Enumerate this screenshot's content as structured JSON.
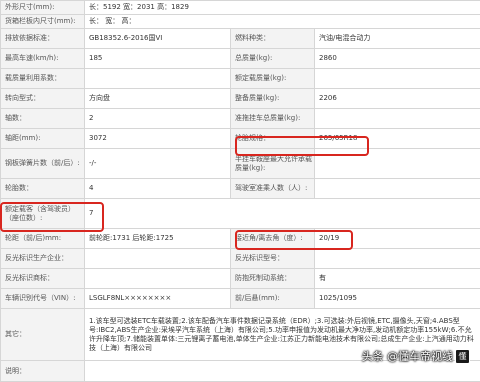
{
  "rows": [
    {
      "k1": "外形尺寸(mm):",
      "v1": "长：5192 宽：2031 高：1829",
      "k2": "",
      "v2": ""
    },
    {
      "k1": "货箱栏板内尺寸(mm):",
      "v1": "长：    宽：    高：",
      "k2": "",
      "v2": ""
    },
    {
      "k1": "排放依据标准：",
      "v1": "GB18352.6-2016国VI",
      "k2": "燃料种类：",
      "v2": "汽油/电混合动力"
    },
    {
      "k1": "最高车速(km/h):",
      "v1": "185",
      "k2": "总质量(kg):",
      "v2": "2860"
    },
    {
      "k1": "载质量利用系数：",
      "v1": "",
      "k2": "额定载质量(kg):",
      "v2": ""
    },
    {
      "k1": "转向型式：",
      "v1": "方向盘",
      "k2": "整备质量(kg):",
      "v2": "2206"
    },
    {
      "k1": "轴数：",
      "v1": "2",
      "k2": "准拖挂车总质量(kg):",
      "v2": ""
    },
    {
      "k1": "轴距(mm):",
      "v1": "3072",
      "k2": "轮胎规格：",
      "v2": "265/65R18"
    },
    {
      "k1": "钢板弹簧片数（前/后）:",
      "v1": "-/-",
      "k2": "半挂车鞍座最大允许承载质量(kg):",
      "v2": ""
    },
    {
      "k1": "轮胎数：",
      "v1": "4",
      "k2": "驾驶室准乘人数（人）:",
      "v2": ""
    },
    {
      "k1": "额定载客（含驾驶员）（座位数）:",
      "v1": "7",
      "k2": "",
      "v2": ""
    },
    {
      "k1": "轮距（前/后)mm:",
      "v1": "前轮距:1731 后轮距:1725",
      "k2": "接近角/离去角（度）:",
      "v2": "20/19"
    },
    {
      "k1": "反光标识生产企业：",
      "v1": "",
      "k2": "反光标识型号：",
      "v2": ""
    },
    {
      "k1": "反光标识商标：",
      "v1": "",
      "k2": "防抱死制动系统：",
      "v2": "有"
    },
    {
      "k1": "车辆识别代号（VIN）:",
      "v1": "LSGLF8NL××××××××",
      "k2": "前/后悬(mm):",
      "v2": "1025/1095"
    },
    {
      "k1": "其它：",
      "v1": "1.该车型可选装ETC车载装置;2.该车配备汽车事件数据记录系统（EDR）;3.可选装:外后视镜,ETC,摄像头,天窗;4.ABS型号:IBC2,ABS生产企业:采埃孚汽车系统（上海）有限公司;5.功率申报值为发动机最大净功率,发动机额定功率155kW;6.不允许升降车顶;7.储能装置单体:三元锂离子蓄电池,单体生产企业:江苏正力新能电池技术有限公司;总成生产企业:上汽通用动力科技（上海）有限公司",
      "k2": "",
      "v2": ""
    },
    {
      "k1": "说明：",
      "v1": "",
      "k2": "",
      "v2": ""
    }
  ],
  "watermark": {
    "text": "头条 @懂车帝视线",
    "logo": "懂"
  },
  "highlight_color": "#d8261f"
}
